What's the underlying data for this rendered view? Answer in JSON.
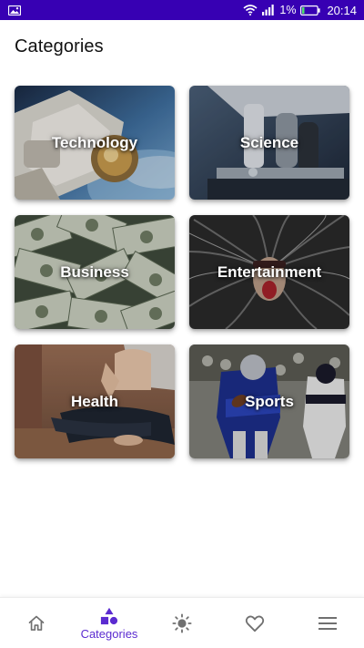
{
  "status_bar": {
    "battery_percent": "1%",
    "time": "20:14"
  },
  "page": {
    "title": "Categories"
  },
  "categories": [
    {
      "label": "Technology",
      "image": "astronaut-spacewalk"
    },
    {
      "label": "Science",
      "image": "microscope"
    },
    {
      "label": "Business",
      "image": "dollar-bills"
    },
    {
      "label": "Entertainment",
      "image": "screaming-face-hair"
    },
    {
      "label": "Health",
      "image": "yoga-pose"
    },
    {
      "label": "Sports",
      "image": "american-football-players"
    }
  ],
  "bottom_nav": {
    "active_index": 1,
    "items": [
      {
        "icon": "home-icon",
        "label": ""
      },
      {
        "icon": "shapes-icon",
        "label": "Categories"
      },
      {
        "icon": "sun-icon",
        "label": ""
      },
      {
        "icon": "heart-icon",
        "label": ""
      },
      {
        "icon": "menu-icon",
        "label": ""
      }
    ]
  },
  "colors": {
    "status_bar": "#3700b3",
    "accent": "#5b2bd0",
    "inactive_icon": "#707070"
  }
}
